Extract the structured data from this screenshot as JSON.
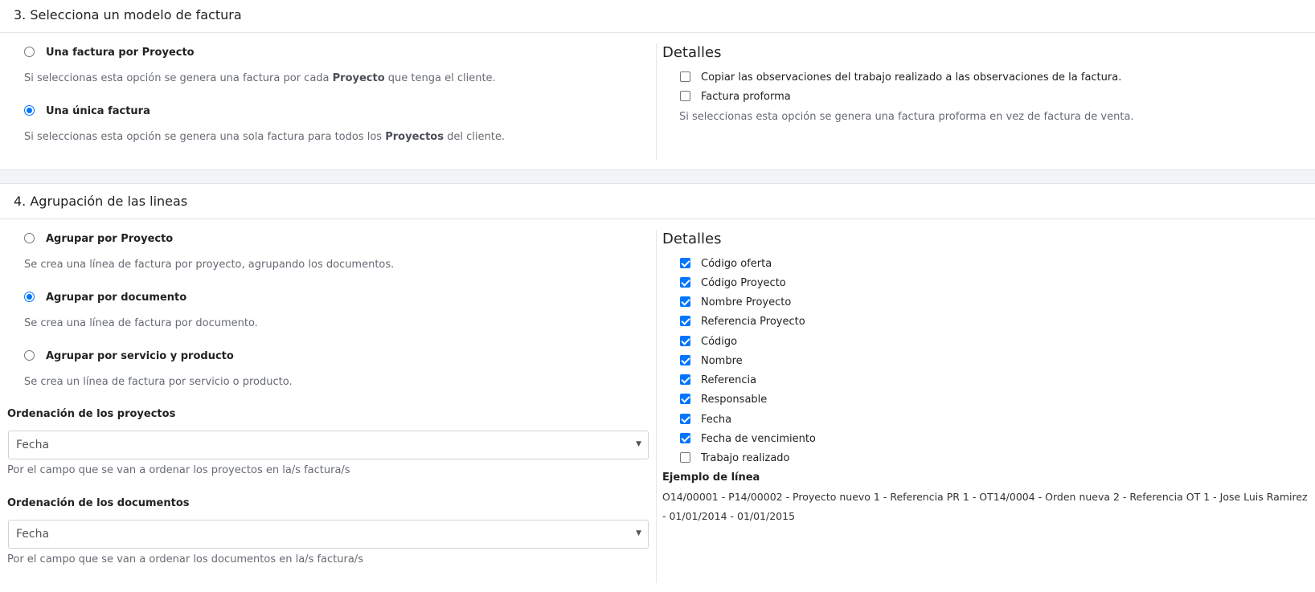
{
  "section3": {
    "title": "3. Selecciona un modelo de factura",
    "options": [
      {
        "label": "Una factura por Proyecto",
        "checked": false,
        "desc_pre": "Si seleccionas esta opción se genera una factura por cada ",
        "desc_bold": "Proyecto",
        "desc_post": " que tenga el cliente."
      },
      {
        "label": "Una única factura",
        "checked": true,
        "desc_pre": "Si seleccionas esta opción se genera una sola factura para todos los ",
        "desc_bold": "Proyectos",
        "desc_post": " del cliente."
      }
    ],
    "details": {
      "title": "Detalles",
      "checkboxes": [
        {
          "label": "Copiar las observaciones del trabajo realizado a las observaciones de la factura.",
          "checked": false
        },
        {
          "label": "Factura proforma",
          "checked": false
        }
      ],
      "help": "Si seleccionas esta opción se genera una factura proforma en vez de factura de venta."
    }
  },
  "section4": {
    "title": "4. Agrupación de las lineas",
    "options": [
      {
        "label": "Agrupar por Proyecto",
        "checked": false,
        "desc": "Se crea una línea de factura por proyecto, agrupando los documentos."
      },
      {
        "label": "Agrupar por documento",
        "checked": true,
        "desc": "Se crea una línea de factura por documento."
      },
      {
        "label": "Agrupar por servicio y producto",
        "checked": false,
        "desc": "Se crea un línea de factura por servicio o producto."
      }
    ],
    "order_projects": {
      "label": "Ordenación de los proyectos",
      "value": "Fecha",
      "help": "Por el campo que se van a ordenar los proyectos en la/s factura/s"
    },
    "order_documents": {
      "label": "Ordenación de los documentos",
      "value": "Fecha",
      "help": "Por el campo que se van a ordenar los documentos en la/s factura/s"
    },
    "details": {
      "title": "Detalles",
      "checkboxes": [
        {
          "label": "Código oferta",
          "checked": true
        },
        {
          "label": "Código Proyecto",
          "checked": true
        },
        {
          "label": "Nombre Proyecto",
          "checked": true
        },
        {
          "label": "Referencia Proyecto",
          "checked": true
        },
        {
          "label": "Código",
          "checked": true
        },
        {
          "label": "Nombre",
          "checked": true
        },
        {
          "label": "Referencia",
          "checked": true
        },
        {
          "label": "Responsable",
          "checked": true
        },
        {
          "label": "Fecha",
          "checked": true
        },
        {
          "label": "Fecha de vencimiento",
          "checked": true
        },
        {
          "label": "Trabajo realizado",
          "checked": false
        }
      ],
      "example_label": "Ejemplo de línea",
      "example_text": "O14/00001 - P14/00002 - Proyecto nuevo 1 - Referencia PR 1 - OT14/0004 - Orden nueva 2 - Referencia OT 1 - Jose Luis Ramirez - 01/01/2014 - 01/01/2015"
    }
  }
}
